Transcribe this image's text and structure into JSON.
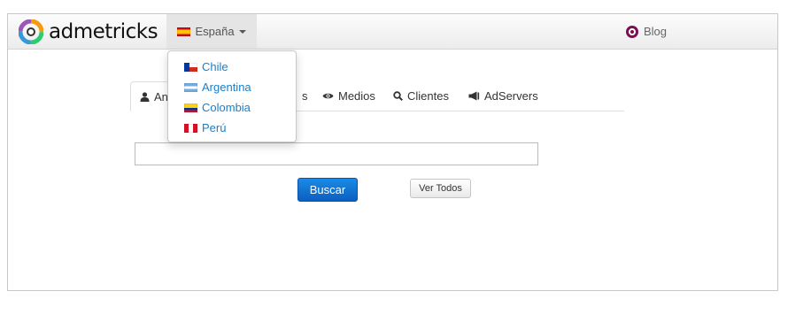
{
  "brand": {
    "name": "admetricks"
  },
  "navbar": {
    "country_label": "España",
    "blog_label": "Blog"
  },
  "dropdown": {
    "items": [
      {
        "label": "Chile",
        "flag": "flag-cl"
      },
      {
        "label": "Argentina",
        "flag": "flag-ar"
      },
      {
        "label": "Colombia",
        "flag": "flag-co"
      },
      {
        "label": "Perú",
        "flag": "flag-pe"
      }
    ]
  },
  "tabs": [
    {
      "label": "An",
      "icon": "user-icon"
    },
    {
      "label": "s",
      "icon": ""
    },
    {
      "label": "Medios",
      "icon": "eye-icon"
    },
    {
      "label": "Clientes",
      "icon": "search-icon"
    },
    {
      "label": "AdServers",
      "icon": "megaphone-icon"
    }
  ],
  "search": {
    "value": "",
    "placeholder": ""
  },
  "buttons": {
    "search_label": "Buscar",
    "view_all_label": "Ver Todos"
  },
  "colors": {
    "primary": "#0b6fd4",
    "link": "#1a7fc8",
    "brand_accent": "#7a1050"
  }
}
